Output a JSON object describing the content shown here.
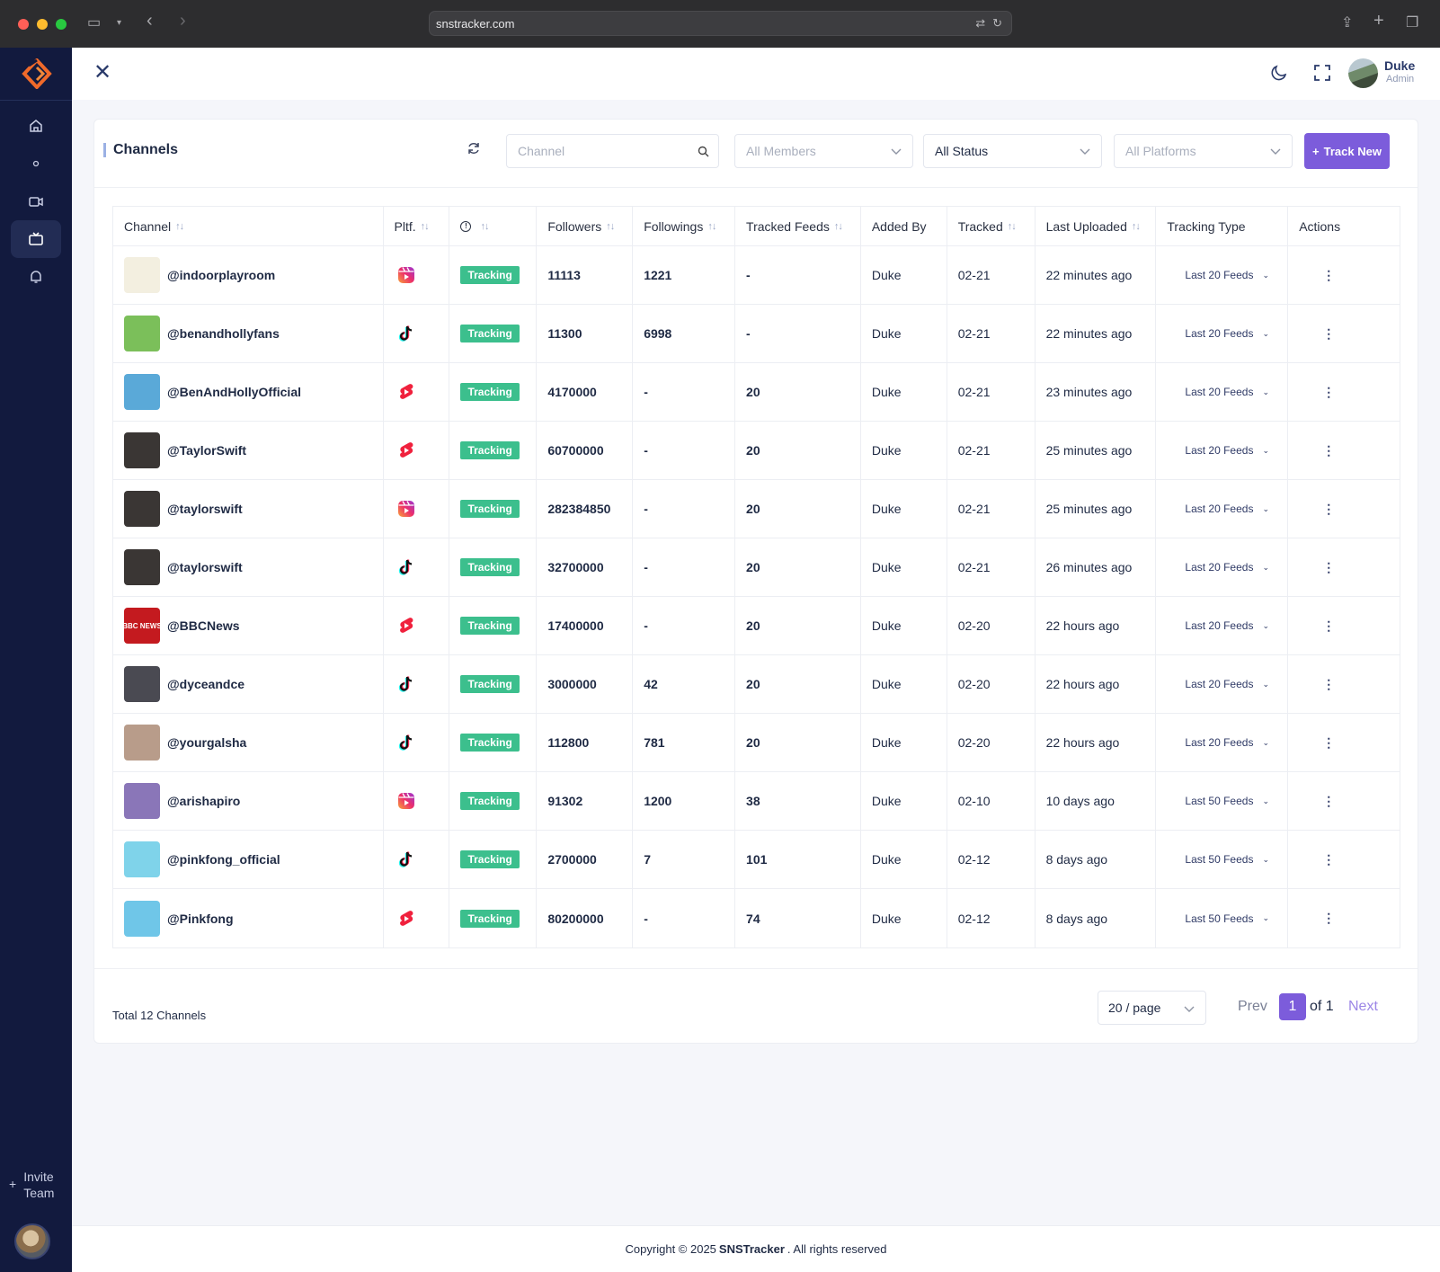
{
  "browser": {
    "url": "snstracker.com"
  },
  "sidebar": {
    "invite_plus": "+",
    "invite_label_1": "Invite",
    "invite_label_2": "Team"
  },
  "header": {
    "user_name": "Duke",
    "user_role": "Admin"
  },
  "card": {
    "title": "Channels",
    "search_placeholder": "Channel",
    "members_select": "All Members",
    "status_select": "All Status",
    "platforms_select": "All Platforms",
    "track_button": "Track New"
  },
  "table": {
    "columns": [
      "Channel",
      "Pltf.",
      "",
      "Followers",
      "Followings",
      "Tracked Feeds",
      "Added By",
      "Tracked",
      "Last Uploaded",
      "Tracking Type",
      "Actions"
    ],
    "rows": [
      {
        "channel": "@indoorplayroom",
        "platform": "instagram-reels",
        "status": "Tracking",
        "followers": "11113",
        "followings": "1221",
        "feeds": "-",
        "added_by": "Duke",
        "tracked": "02-21",
        "last_uploaded": "22 minutes ago",
        "type": "Last 20 Feeds",
        "avatar": "#f3efe0"
      },
      {
        "channel": "@benandhollyfans",
        "platform": "tiktok",
        "status": "Tracking",
        "followers": "11300",
        "followings": "6998",
        "feeds": "-",
        "added_by": "Duke",
        "tracked": "02-21",
        "last_uploaded": "22 minutes ago",
        "type": "Last 20 Feeds",
        "avatar": "#7bbf5a"
      },
      {
        "channel": "@BenAndHollyOfficial",
        "platform": "youtube-shorts",
        "status": "Tracking",
        "followers": "4170000",
        "followings": "-",
        "feeds": "20",
        "added_by": "Duke",
        "tracked": "02-21",
        "last_uploaded": "23 minutes ago",
        "type": "Last 20 Feeds",
        "avatar": "#5aa9d8"
      },
      {
        "channel": "@TaylorSwift",
        "platform": "youtube-shorts",
        "status": "Tracking",
        "followers": "60700000",
        "followings": "-",
        "feeds": "20",
        "added_by": "Duke",
        "tracked": "02-21",
        "last_uploaded": "25 minutes ago",
        "type": "Last 20 Feeds",
        "avatar": "#3a3634"
      },
      {
        "channel": "@taylorswift",
        "platform": "instagram-reels",
        "status": "Tracking",
        "followers": "282384850",
        "followings": "-",
        "feeds": "20",
        "added_by": "Duke",
        "tracked": "02-21",
        "last_uploaded": "25 minutes ago",
        "type": "Last 20 Feeds",
        "avatar": "#3a3634"
      },
      {
        "channel": "@taylorswift",
        "platform": "tiktok",
        "status": "Tracking",
        "followers": "32700000",
        "followings": "-",
        "feeds": "20",
        "added_by": "Duke",
        "tracked": "02-21",
        "last_uploaded": "26 minutes ago",
        "type": "Last 20 Feeds",
        "avatar": "#3a3634"
      },
      {
        "channel": "@BBCNews",
        "platform": "youtube-shorts",
        "status": "Tracking",
        "followers": "17400000",
        "followings": "-",
        "feeds": "20",
        "added_by": "Duke",
        "tracked": "02-20",
        "last_uploaded": "22 hours ago",
        "type": "Last 20 Feeds",
        "avatar": "#c41a1f",
        "avatar_text": "BBC NEWS"
      },
      {
        "channel": "@dyceandce",
        "platform": "tiktok",
        "status": "Tracking",
        "followers": "3000000",
        "followings": "42",
        "feeds": "20",
        "added_by": "Duke",
        "tracked": "02-20",
        "last_uploaded": "22 hours ago",
        "type": "Last 20 Feeds",
        "avatar": "#4a4a52"
      },
      {
        "channel": "@yourgalsha",
        "platform": "tiktok",
        "status": "Tracking",
        "followers": "112800",
        "followings": "781",
        "feeds": "20",
        "added_by": "Duke",
        "tracked": "02-20",
        "last_uploaded": "22 hours ago",
        "type": "Last 20 Feeds",
        "avatar": "#b89c8a"
      },
      {
        "channel": "@arishapiro",
        "platform": "instagram-reels",
        "status": "Tracking",
        "followers": "91302",
        "followings": "1200",
        "feeds": "38",
        "added_by": "Duke",
        "tracked": "02-10",
        "last_uploaded": "10 days ago",
        "type": "Last 50 Feeds",
        "avatar": "#8a76b8"
      },
      {
        "channel": "@pinkfong_official",
        "platform": "tiktok",
        "status": "Tracking",
        "followers": "2700000",
        "followings": "7",
        "feeds": "101",
        "added_by": "Duke",
        "tracked": "02-12",
        "last_uploaded": "8 days ago",
        "type": "Last 50 Feeds",
        "avatar": "#7fd3ea"
      },
      {
        "channel": "@Pinkfong",
        "platform": "youtube-shorts",
        "status": "Tracking",
        "followers": "80200000",
        "followings": "-",
        "feeds": "74",
        "added_by": "Duke",
        "tracked": "02-12",
        "last_uploaded": "8 days ago",
        "type": "Last 50 Feeds",
        "avatar": "#6fc6e8"
      }
    ]
  },
  "pagination": {
    "total": "Total 12 Channels",
    "per_page": "20 / page",
    "prev": "Prev",
    "current": "1",
    "of": "of 1",
    "next": "Next"
  },
  "footer": {
    "pre": "Copyright © 2025",
    "brand": "SNSTracker",
    "post": ". All rights reserved"
  },
  "colors": {
    "accent": "#7c5cdb",
    "sidebar": "#121a3e",
    "tracking_badge": "#3cbf8d"
  }
}
